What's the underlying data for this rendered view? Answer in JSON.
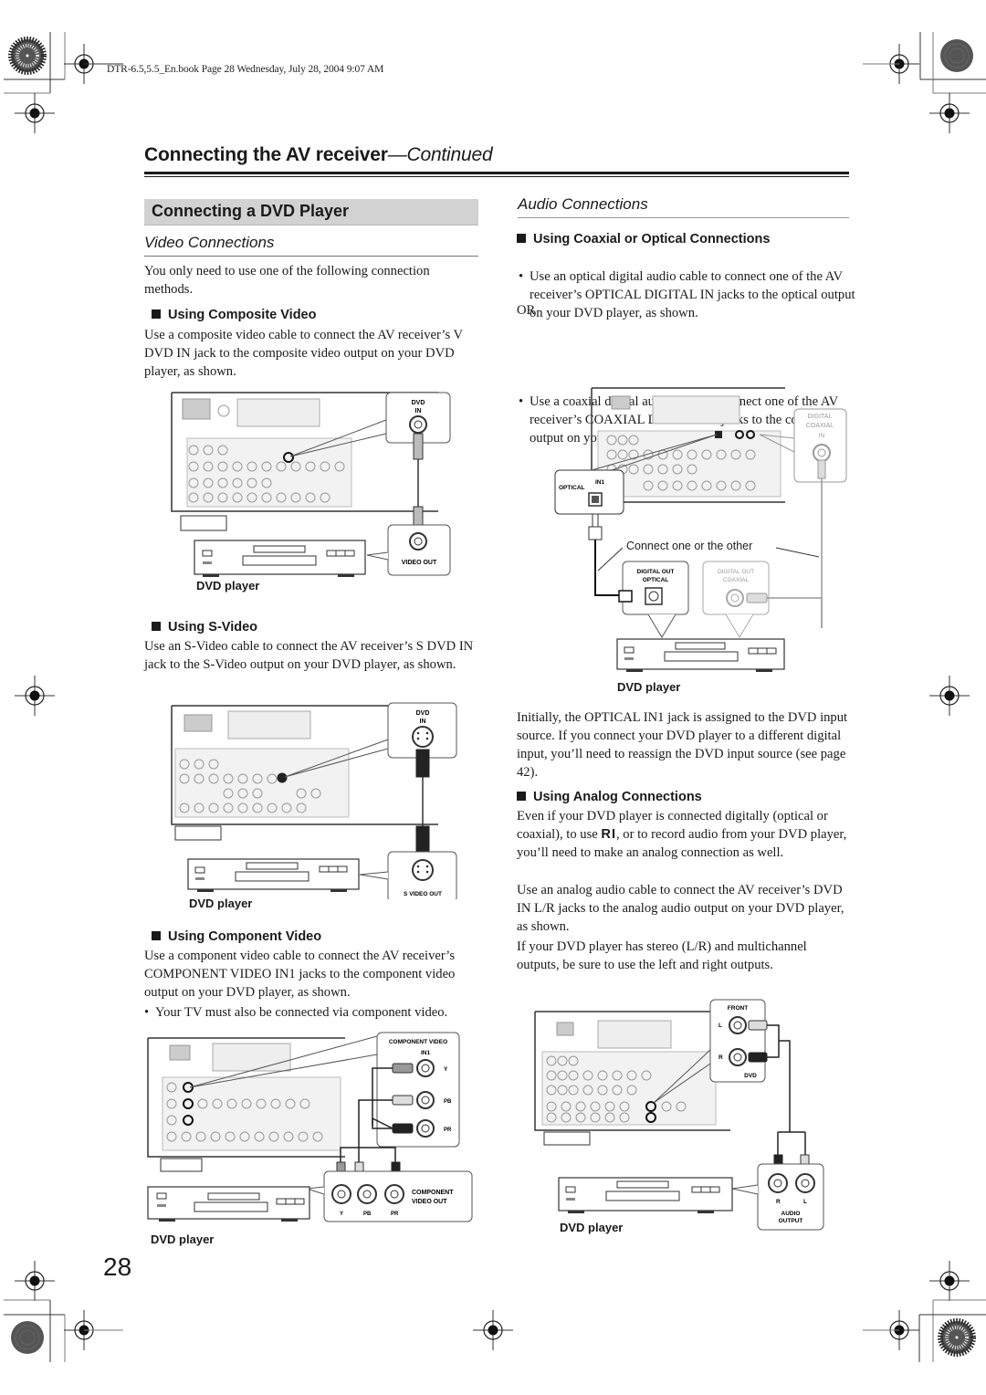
{
  "print_info": "DTR-6.5,5.5_En.book  Page 28  Wednesday, July 28, 2004  9:07 AM",
  "header": {
    "title": "Connecting the AV receiver",
    "title_suffix": "—Continued"
  },
  "section_title": "Connecting a DVD Player",
  "video": {
    "heading": "Video Connections",
    "intro": "You only need to use one of the following connection methods.",
    "composite": {
      "heading": "Using Composite Video",
      "text": "Use a composite video cable to connect the AV receiver’s V DVD IN jack to the composite video output on your DVD player, as shown.",
      "diagram": {
        "jack_in_label_1": "DVD",
        "jack_in_label_2": "IN",
        "jack_out_label": "VIDEO OUT",
        "player_label": "DVD player"
      }
    },
    "svideo": {
      "heading": "Using S-Video",
      "text": "Use an S-Video cable to connect the AV receiver’s S DVD IN jack to the S-Video output on your DVD player, as shown.",
      "diagram": {
        "jack_in_label_1": "DVD",
        "jack_in_label_2": "IN",
        "jack_out_label": "S VIDEO OUT",
        "player_label": "DVD player"
      }
    },
    "component": {
      "heading": "Using Component Video",
      "text": "Use a component video cable to connect the AV receiver’s COMPONENT VIDEO IN1 jacks to the component video output on your DVD player, as shown.",
      "note": "Your TV must also be connected via component video.",
      "diagram": {
        "in_label_1": "COMPONENT VIDEO",
        "in_label_2": "IN1",
        "jacks": [
          "Y",
          "PB",
          "PR"
        ],
        "out_label_1": "COMPONENT",
        "out_label_2": "VIDEO  OUT",
        "player_label": "DVD player"
      }
    }
  },
  "audio": {
    "heading": "Audio Connections",
    "digital": {
      "heading": "Using Coaxial or Optical Connections",
      "bullet_1": "Use an optical digital audio cable to connect one of the AV receiver’s OPTICAL DIGITAL IN jacks to the optical output on your DVD player, as shown.",
      "or": "OR",
      "bullet_2": "Use a coaxial digital audio cable to connect one of the AV receiver’s COAXIAL DIGITAL IN jacks to the coaxial output on your DVD player, as shown.",
      "diagram": {
        "coax_in_1": "DIGITAL",
        "coax_in_2": "COAXIAL",
        "coax_in_3": "IN",
        "opt_in_1": "IN1",
        "opt_in_2": "OPTICAL",
        "connect_note": "Connect one or the other",
        "opt_out_1": "DIGITAL OUT",
        "opt_out_2": "OPTICAL",
        "coax_out_1": "DIGITAL OUT",
        "coax_out_2": "COAXIAL",
        "player_label": "DVD player"
      },
      "note": "Initially, the OPTICAL IN1 jack is assigned to the DVD input source. If you connect your DVD player to a different digital input, you’ll need to reassign the DVD input source (see page 42)."
    },
    "analog": {
      "heading": "Using Analog Connections",
      "text_1a": "Even if your DVD player is connected digitally (optical or coaxial), to use ",
      "ri_symbol": "RI",
      "text_1b": ", or to record audio from your DVD player, you’ll need to make an analog connection as well.",
      "text_2": "Use an analog audio cable to connect the AV receiver’s DVD IN L/R jacks to the analog audio output on your DVD player, as shown.",
      "text_3": "If your DVD player has stereo (L/R) and multichannel outputs, be sure to use the left and right outputs.",
      "diagram": {
        "in_label_top": "FRONT",
        "in_l": "L",
        "in_r": "R",
        "in_label_bottom": "DVD",
        "out_r": "R",
        "out_l": "L",
        "out_label_1": "AUDIO",
        "out_label_2": "OUTPUT",
        "player_label": "DVD player"
      }
    }
  },
  "page_number": "28"
}
